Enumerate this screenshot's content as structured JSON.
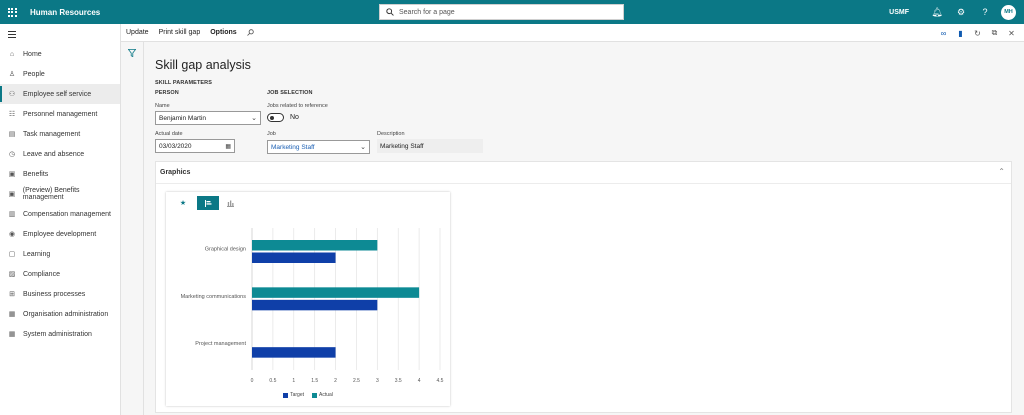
{
  "topbar": {
    "app_title": "Human Resources",
    "search_placeholder": "Search for a page",
    "company": "USMF",
    "user_initials": "MH"
  },
  "nav": {
    "items": [
      {
        "label": "Home",
        "icon": "home-icon",
        "glyph": "⌂"
      },
      {
        "label": "People",
        "icon": "people-icon",
        "glyph": "♙"
      },
      {
        "label": "Employee self service",
        "icon": "self-service-icon",
        "glyph": "⚇",
        "active": true
      },
      {
        "label": "Personnel management",
        "icon": "personnel-icon",
        "glyph": "☷"
      },
      {
        "label": "Task management",
        "icon": "task-icon",
        "glyph": "▤"
      },
      {
        "label": "Leave and absence",
        "icon": "leave-icon",
        "glyph": "◷"
      },
      {
        "label": "Benefits",
        "icon": "benefits-icon",
        "glyph": "▣"
      },
      {
        "label": "(Preview) Benefits management",
        "icon": "benefits-management-icon",
        "glyph": "▣"
      },
      {
        "label": "Compensation management",
        "icon": "compensation-icon",
        "glyph": "▥"
      },
      {
        "label": "Employee development",
        "icon": "development-icon",
        "glyph": "◉"
      },
      {
        "label": "Learning",
        "icon": "learning-icon",
        "glyph": "▢"
      },
      {
        "label": "Compliance",
        "icon": "compliance-icon",
        "glyph": "▨"
      },
      {
        "label": "Business processes",
        "icon": "processes-icon",
        "glyph": "⊞"
      },
      {
        "label": "Organisation administration",
        "icon": "org-admin-icon",
        "glyph": "▦"
      },
      {
        "label": "System administration",
        "icon": "system-admin-icon",
        "glyph": "▦"
      }
    ]
  },
  "actionbar": {
    "update": "Update",
    "print_skill_gap": "Print skill gap",
    "options": "Options"
  },
  "page": {
    "title": "Skill gap analysis",
    "skill_parameters": "SKILL PARAMETERS",
    "person_header": "PERSON",
    "job_selection_header": "JOB SELECTION",
    "name_label": "Name",
    "name_value": "Benjamin Martin",
    "actual_date_label": "Actual date",
    "actual_date_value": "03/03/2020",
    "jobs_related_label": "Jobs related to reference",
    "jobs_related_value": "No",
    "job_label": "Job",
    "job_value": "Marketing Staff",
    "description_label": "Description",
    "description_value": "Marketing Staff"
  },
  "graphics": {
    "title": "Graphics"
  },
  "colors": {
    "brand": "#0b7886",
    "target": "#0f3fa8",
    "actual": "#0d8a94"
  },
  "chart_data": {
    "type": "bar",
    "orientation": "horizontal",
    "categories": [
      "Graphical design",
      "Marketing communications",
      "Project management"
    ],
    "series": [
      {
        "name": "Target",
        "values": [
          2,
          3,
          2
        ]
      },
      {
        "name": "Actual",
        "values": [
          3,
          4,
          0
        ]
      }
    ],
    "xlim": [
      0,
      4.5
    ],
    "xticks": [
      "0",
      "0.5",
      "1",
      "1.5",
      "2",
      "2.5",
      "3",
      "3.5",
      "4",
      "4.5"
    ],
    "grid": true,
    "legend": "bottom"
  }
}
